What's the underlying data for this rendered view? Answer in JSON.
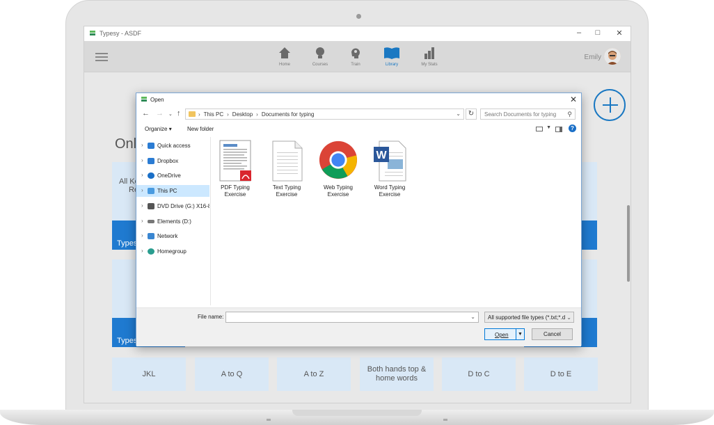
{
  "window": {
    "title": "Typesy - ASDF"
  },
  "nav": {
    "items": [
      {
        "label": "Home",
        "icon": "home-icon"
      },
      {
        "label": "Courses",
        "icon": "lightbulb-icon"
      },
      {
        "label": "Train",
        "icon": "brain-icon"
      },
      {
        "label": "Library",
        "icon": "book-icon",
        "active": true
      },
      {
        "label": "My Stats",
        "icon": "bar-chart-icon"
      }
    ],
    "user_name": "Emily"
  },
  "main": {
    "heading_partial": "Onl",
    "card1_text": "All Ke",
    "card1_text2": "Re",
    "card1_band": "Types",
    "card2_band": "Types",
    "tiles": [
      "JKL",
      "A to Q",
      "A to Z",
      "Both hands top & home words",
      "D to C",
      "D to E"
    ]
  },
  "dialog": {
    "title": "Open",
    "breadcrumbs": [
      "This PC",
      "Desktop",
      "Documents for typing"
    ],
    "search_placeholder": "Search Documents for typing",
    "organize_label": "Organize",
    "new_folder_label": "New folder",
    "nav_items": [
      {
        "label": "Quick access",
        "icon": "star-icon",
        "color": "#2b7cd3"
      },
      {
        "label": "Dropbox",
        "icon": "dropbox-icon",
        "color": "#2b7cd3"
      },
      {
        "label": "OneDrive",
        "icon": "cloud-icon",
        "color": "#1a6fc7"
      },
      {
        "label": "This PC",
        "icon": "computer-icon",
        "color": "#4a9be0",
        "selected": true
      },
      {
        "label": "DVD Drive (G:) X16-8",
        "icon": "dvd-icon",
        "color": "#555555"
      },
      {
        "label": "Elements (D:)",
        "icon": "drive-icon",
        "color": "#777777"
      },
      {
        "label": "Network",
        "icon": "network-icon",
        "color": "#3a86d1"
      },
      {
        "label": "Homegroup",
        "icon": "homegroup-icon",
        "color": "#2a9d8f"
      }
    ],
    "files": [
      {
        "line1": "PDF Typing",
        "line2": "Exercise",
        "icon": "pdf-document-icon"
      },
      {
        "line1": "Text Typing",
        "line2": "Exercise",
        "icon": "text-document-icon"
      },
      {
        "line1": "Web Typing",
        "line2": "Exercise",
        "icon": "chrome-icon"
      },
      {
        "line1": "Word Typing",
        "line2": "Exercise",
        "icon": "word-document-icon"
      }
    ],
    "file_name_label": "File name:",
    "file_name_value": "",
    "file_type": "All supported file types (*.txt;*.d",
    "open_label": "Open",
    "cancel_label": "Cancel"
  },
  "colors": {
    "accent": "#1a78c2",
    "band": "#1f7ad0",
    "card": "#d9e8f6"
  }
}
